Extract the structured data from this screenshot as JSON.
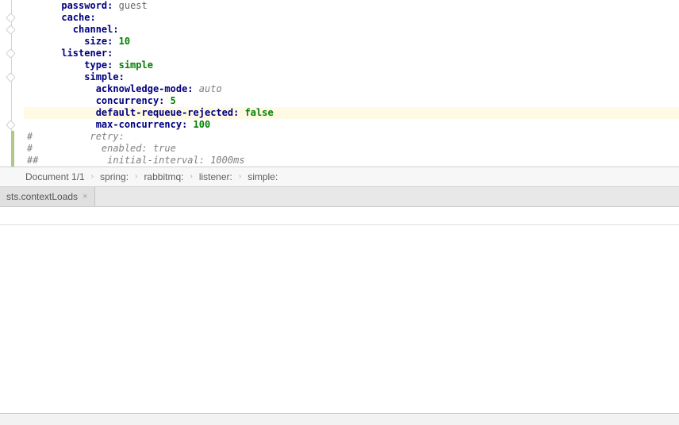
{
  "code": {
    "lines": [
      {
        "indent": 6,
        "key": "password",
        "sep": ": ",
        "val": "guest",
        "valClass": "k-plain"
      },
      {
        "indent": 6,
        "key": "cache",
        "sep": ":",
        "val": ""
      },
      {
        "indent": 8,
        "key": "channel",
        "sep": ":",
        "val": ""
      },
      {
        "indent": 10,
        "key": "size",
        "sep": ": ",
        "val": "10",
        "valClass": "k-val"
      },
      {
        "indent": 6,
        "key": "listener",
        "sep": ":",
        "val": ""
      },
      {
        "indent": 10,
        "key": "type",
        "sep": ": ",
        "val": "simple",
        "valClass": "k-val"
      },
      {
        "indent": 10,
        "key": "simple",
        "sep": ":",
        "val": ""
      },
      {
        "indent": 12,
        "key": "acknowledge-mode",
        "sep": ": ",
        "val": "auto",
        "valClass": "k-valg"
      },
      {
        "indent": 12,
        "key": "concurrency",
        "sep": ": ",
        "val": "5",
        "valClass": "k-val"
      },
      {
        "indent": 12,
        "key": "default-requeue-rejected",
        "sep": ": ",
        "val": "false",
        "valClass": "k-val",
        "hl": true
      },
      {
        "indent": 12,
        "key": "max-concurrency",
        "sep": ": ",
        "val": "100",
        "valClass": "k-val"
      },
      {
        "raw_comment": true,
        "hash": "#",
        "text": "          retry:"
      },
      {
        "raw_comment": true,
        "hash": "#",
        "text": "            enabled: true"
      },
      {
        "raw_comment": true,
        "hash": "##",
        "text": "            initial-interval: 1000ms"
      }
    ]
  },
  "breadcrumb": {
    "doc": "Document 1/1",
    "parts": [
      "spring:",
      "rabbitmq:",
      "listener:",
      "simple:"
    ]
  },
  "tab": {
    "label": "sts.contextLoads",
    "close": "×"
  }
}
